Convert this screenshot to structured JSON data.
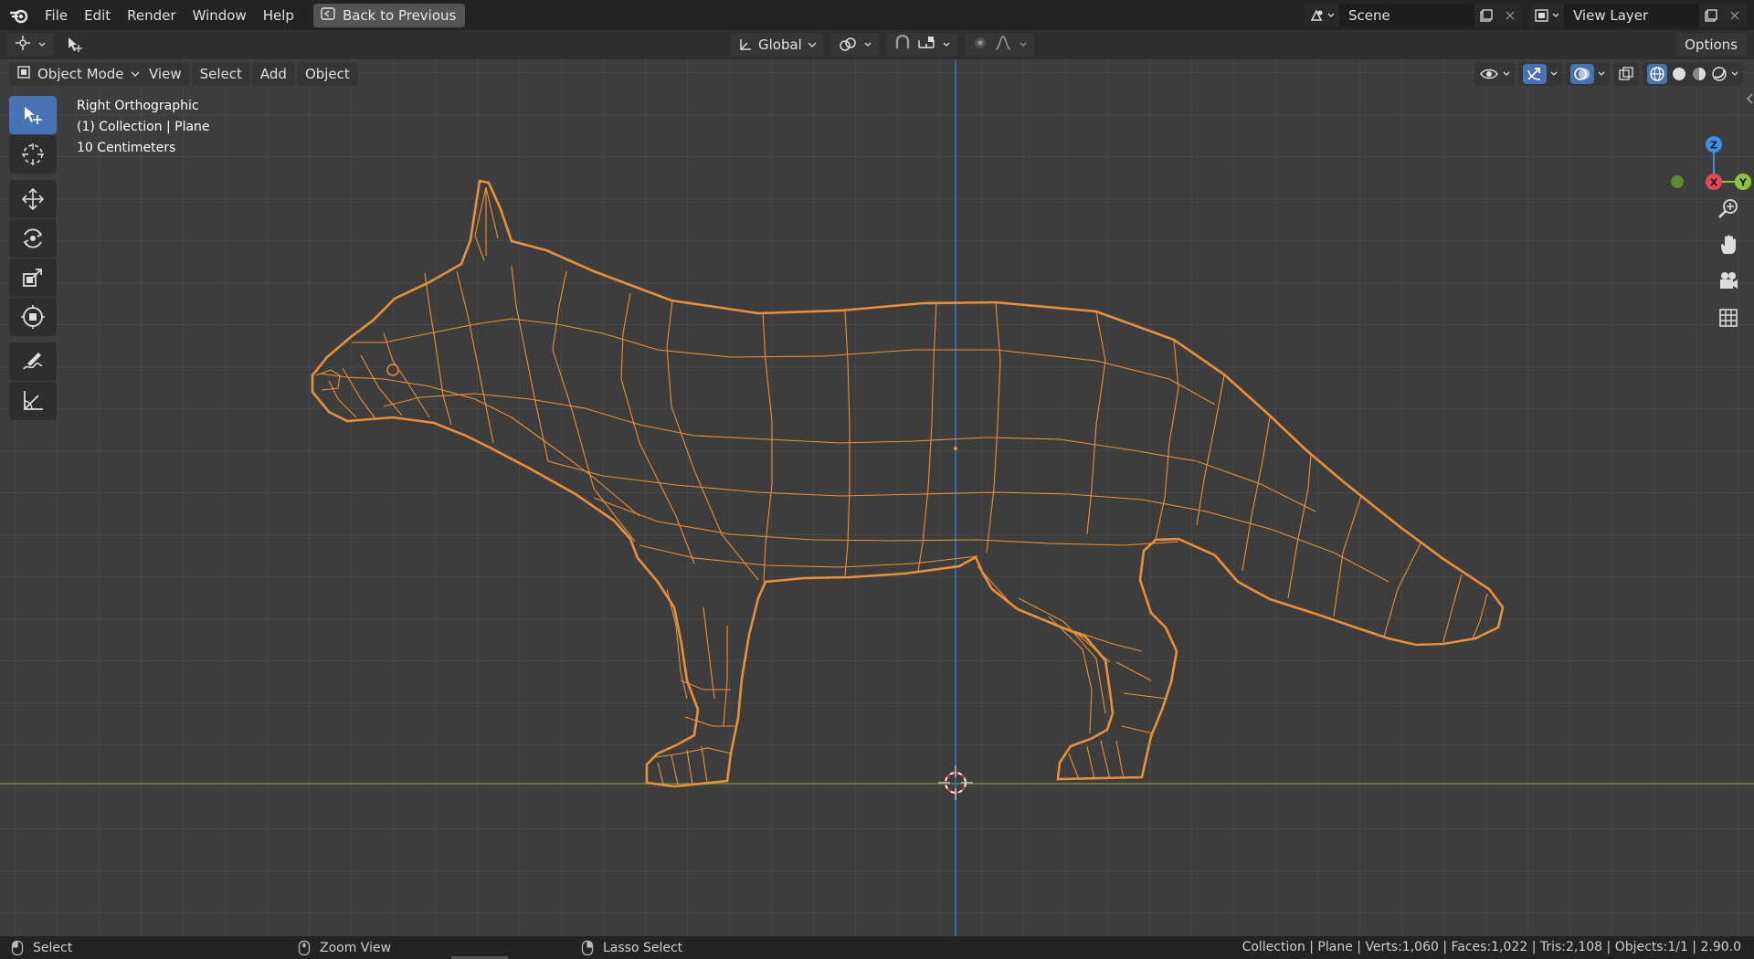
{
  "topbar": {
    "menus": [
      "File",
      "Edit",
      "Render",
      "Window",
      "Help"
    ],
    "back_button": "Back to Previous",
    "scene": "Scene",
    "view_layer": "View Layer"
  },
  "header": {
    "orientation": "Global",
    "options": "Options"
  },
  "viewport": {
    "mode": "Object Mode",
    "menus": [
      "View",
      "Select",
      "Add",
      "Object"
    ],
    "overlay_lines": [
      "Right Orthographic",
      "(1) Collection | Plane",
      "10 Centimeters"
    ],
    "gizmo_axes": [
      "Z",
      "X",
      "Y"
    ]
  },
  "statusbar": {
    "left_action": "Select",
    "middle_action": "Zoom View",
    "right_action": "Lasso Select",
    "stats": "Collection | Plane | Verts:1,060 | Faces:1,022 | Tris:2,108 | Objects:1/1 | 2.90.0"
  },
  "colors": {
    "accent": "#4772b3",
    "selected_wire": "#e8913a",
    "x_axis": "#e8455a",
    "y_axis": "#8cc43a",
    "z_axis": "#3f8fe8",
    "floor_line": "#6a8f3a"
  },
  "icons": [
    "blender-logo-icon",
    "back-icon",
    "editor-type-icon",
    "select-box-icon",
    "cursor-icon",
    "move-icon",
    "rotate-icon",
    "scale-icon",
    "transform-icon",
    "annotate-icon",
    "measure-icon",
    "zoom-icon",
    "hand-icon",
    "camera-icon",
    "grid-icon"
  ]
}
